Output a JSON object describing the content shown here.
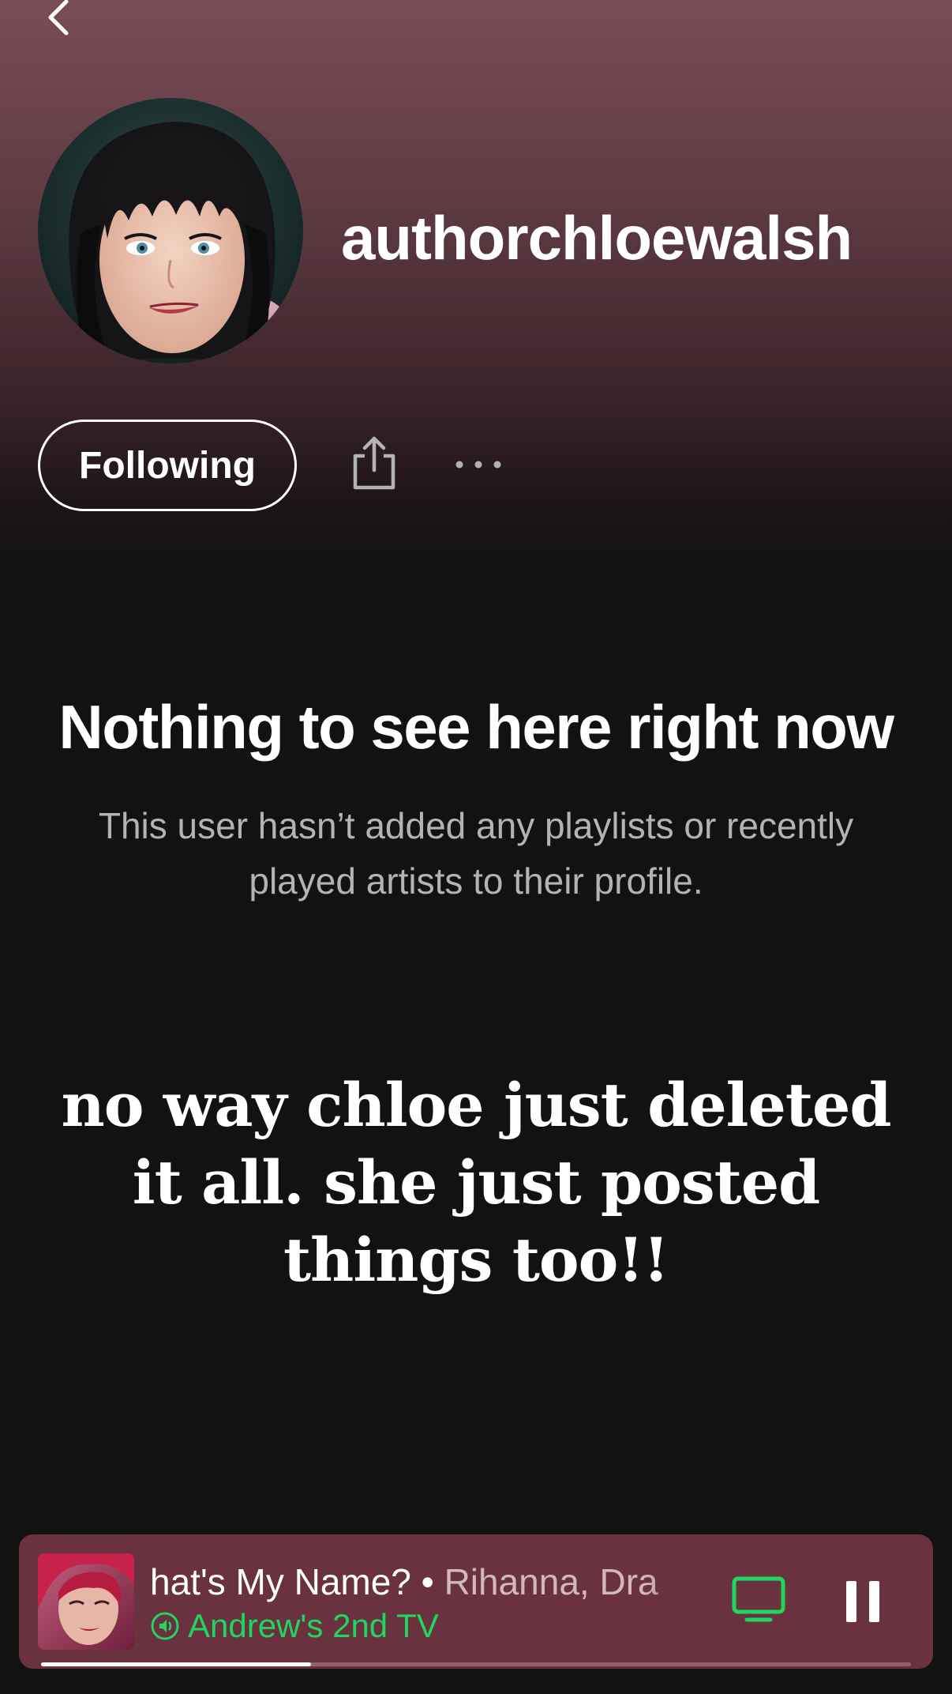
{
  "header": {
    "back_icon": "chevron-left-icon",
    "username": "authorchloewalsh"
  },
  "actions": {
    "follow_label": "Following",
    "share_icon": "share-icon",
    "more_icon": "more-horizontal-icon"
  },
  "empty_state": {
    "title": "Nothing to see here right now",
    "subtitle": "This user hasn’t added any playlists or recently played artists to their profile."
  },
  "caption": {
    "text": "no way chloe just deleted it all. she just posted things too!!"
  },
  "now_playing": {
    "track": "hat's My Name?",
    "separator": " • ",
    "artists": "Rihanna, Dra",
    "device": "Andrew's 2nd TV",
    "progress_fraction": 0.31,
    "device_icon": "tv-icon",
    "pause_icon": "pause-icon"
  },
  "colors": {
    "accent_green": "#1ed760",
    "player_bg": "#6a313e",
    "header_gradient_top": "#7a4c56",
    "background": "#121212"
  }
}
